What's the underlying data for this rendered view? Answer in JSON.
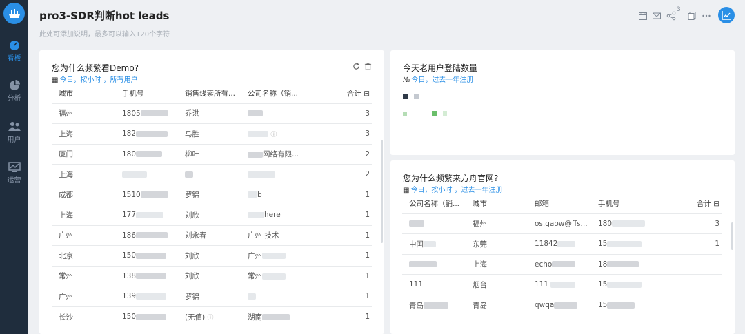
{
  "app": {
    "sidebar": [
      {
        "label": "看板",
        "icon": "dashboard-icon"
      },
      {
        "label": "分析",
        "icon": "pie-chart-icon"
      },
      {
        "label": "用户",
        "icon": "users-icon"
      },
      {
        "label": "运营",
        "icon": "operations-icon"
      }
    ]
  },
  "header": {
    "title": "pro3-SDR判断hot leads",
    "description": "此处可添加说明，最多可以输入120个字符",
    "share_count": "3"
  },
  "card1": {
    "title": "您为什么频繁看Demo?",
    "sub_icon": "▦",
    "sub_today": "今日",
    "sub_rest": "，按小时 ，所有用户",
    "columns": [
      "城市",
      "手机号",
      "销售线索所有...",
      "公司名称（销...",
      "合计 ⊟"
    ],
    "rows": [
      {
        "city": "福州",
        "phone": "1805",
        "owner": "乔洪",
        "company": "",
        "sum": "3"
      },
      {
        "city": "上海",
        "phone": "182",
        "owner": "马胜",
        "company": "",
        "sum": "3"
      },
      {
        "city": "厦门",
        "phone": "180",
        "owner": "柳叶",
        "company": "网络有限...",
        "sum": "2"
      },
      {
        "city": "上海",
        "phone": "",
        "owner": "",
        "company": "",
        "sum": "2"
      },
      {
        "city": "成都",
        "phone": "1510",
        "owner": "罗锦",
        "company": "b",
        "sum": "1"
      },
      {
        "city": "上海",
        "phone": "177",
        "owner": "刘欣",
        "company": "here",
        "sum": "1"
      },
      {
        "city": "广州",
        "phone": "186",
        "owner": "刘永春",
        "company": "广州 技术",
        "sum": "1"
      },
      {
        "city": "北京",
        "phone": "150",
        "owner": "刘欣",
        "company": "广州",
        "sum": "1"
      },
      {
        "city": "常州",
        "phone": "138",
        "owner": "刘欣",
        "company": "常州",
        "sum": "1"
      },
      {
        "city": "广州",
        "phone": "139",
        "owner": "罗锦",
        "company": "",
        "sum": "1"
      },
      {
        "city": "长沙",
        "phone": "150",
        "owner": "(无值)",
        "company": "湖南",
        "sum": "1"
      }
    ]
  },
  "card2": {
    "title": "今天老用户登陆数量",
    "sub_icon": "№",
    "sub_today": "今日",
    "sub_rest": "，过去一年注册"
  },
  "card3": {
    "title": "您为什么频繁来方舟官网?",
    "sub_icon": "▦",
    "sub_today": "今日",
    "sub_rest": "，按小时 ，过去一年注册",
    "columns": [
      "公司名称（销...",
      "城市",
      "邮箱",
      "手机号",
      "合计 ⊟"
    ],
    "rows": [
      {
        "company": "",
        "city": "福州",
        "email": "os.gaow@ffs...",
        "phone": "180",
        "sum": "3"
      },
      {
        "company": "中国",
        "city": "东莞",
        "email": "11842",
        "phone": "15",
        "sum": "1"
      },
      {
        "company": "",
        "city": "上海",
        "email": "echo",
        "phone": "18",
        "sum": ""
      },
      {
        "company": "111",
        "city": "烟台",
        "email": "111",
        "phone": "15",
        "sum": ""
      },
      {
        "company": "青岛",
        "city": "青岛",
        "email": "qwqa",
        "phone": "15",
        "sum": ""
      }
    ]
  },
  "colors": {
    "accent": "#2a8fe6",
    "sidebar_bg": "#1f2d3d",
    "legend_dark": "#2f3a48",
    "legend_light": "#c4c9d0",
    "legend_green": "#6bbf6b",
    "legend_green_light": "#b5ddb5"
  }
}
